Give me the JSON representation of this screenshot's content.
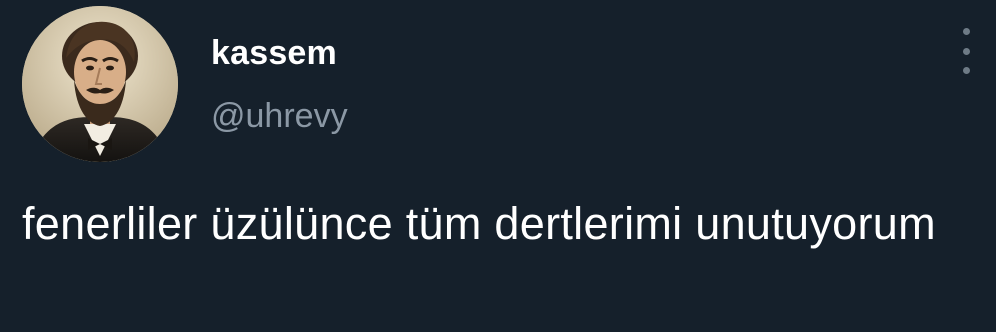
{
  "tweet": {
    "author": {
      "display_name": "kassem",
      "handle": "@uhrevy",
      "avatar_icon": "portrait-engraving"
    },
    "more_icon": "more-vertical-icon",
    "text": "fenerliler üzülünce tüm dertlerimi unutuyorum"
  },
  "colors": {
    "background": "#15202b",
    "name": "#ffffff",
    "handle": "#8b98a5",
    "text": "#ffffff",
    "more_dots": "#6e7b86"
  }
}
